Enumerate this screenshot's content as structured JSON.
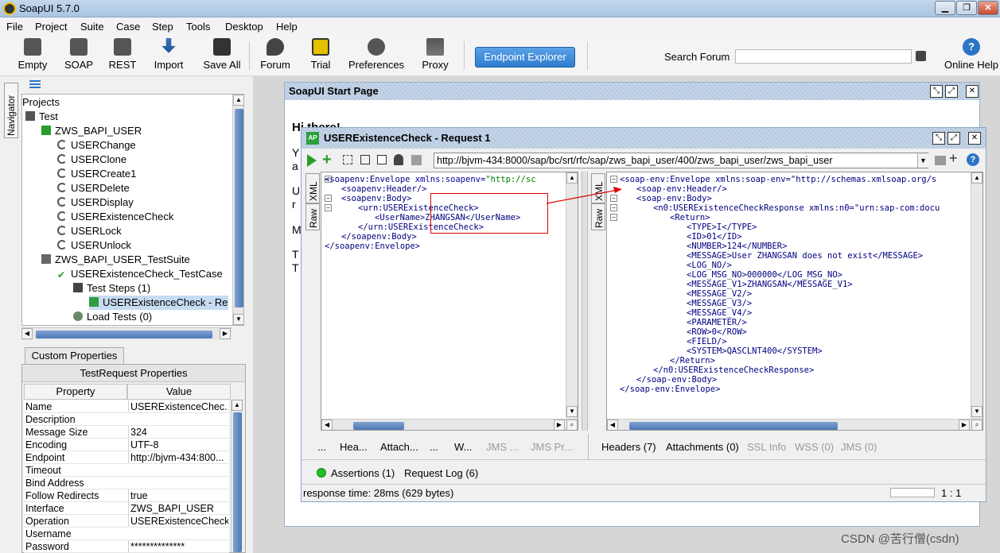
{
  "app": {
    "title": "SoapUI 5.7.0"
  },
  "menu": [
    "File",
    "Project",
    "Suite",
    "Case",
    "Step",
    "Tools",
    "Desktop",
    "Help"
  ],
  "toolbar": {
    "buttons": [
      "Empty",
      "SOAP",
      "REST",
      "Import",
      "Save All",
      "Forum",
      "Trial",
      "Preferences",
      "Proxy"
    ],
    "endpoint_explorer": "Endpoint Explorer",
    "search_label": "Search Forum",
    "online_help": "Online Help"
  },
  "navigator": {
    "tab": "Navigator",
    "header": "Projects",
    "tree": [
      {
        "label": "Test",
        "icon": "folder-icon"
      },
      {
        "label": "ZWS_BAPI_USER",
        "icon": "interface-icon"
      },
      {
        "label": "USERChange",
        "icon": "operation-icon"
      },
      {
        "label": "USERClone",
        "icon": "operation-icon"
      },
      {
        "label": "USERCreate1",
        "icon": "operation-icon"
      },
      {
        "label": "USERDelete",
        "icon": "operation-icon"
      },
      {
        "label": "USERDisplay",
        "icon": "operation-icon"
      },
      {
        "label": "USERExistenceCheck",
        "icon": "operation-icon"
      },
      {
        "label": "USERLock",
        "icon": "operation-icon"
      },
      {
        "label": "USERUnlock",
        "icon": "operation-icon"
      },
      {
        "label": "ZWS_BAPI_USER_TestSuite",
        "icon": "testsuite-icon"
      },
      {
        "label": "USERExistenceCheck_TestCase",
        "icon": "check-icon"
      },
      {
        "label": "Test Steps (1)",
        "icon": "steps-icon"
      },
      {
        "label": "USERExistenceCheck - Re",
        "icon": "request-icon"
      },
      {
        "label": "Load Tests (0)",
        "icon": "loadtest-icon"
      }
    ]
  },
  "properties": {
    "tab": "Custom Properties",
    "title": "TestRequest Properties",
    "col_property": "Property",
    "col_value": "Value",
    "rows": [
      {
        "k": "Name",
        "v": "USERExistenceChec..."
      },
      {
        "k": "Description",
        "v": ""
      },
      {
        "k": "Message Size",
        "v": "324"
      },
      {
        "k": "Encoding",
        "v": "UTF-8"
      },
      {
        "k": "Endpoint",
        "v": "http://bjvm-434:800..."
      },
      {
        "k": "Timeout",
        "v": ""
      },
      {
        "k": "Bind Address",
        "v": ""
      },
      {
        "k": "Follow Redirects",
        "v": "true"
      },
      {
        "k": "Interface",
        "v": "ZWS_BAPI_USER"
      },
      {
        "k": "Operation",
        "v": "USERExistenceCheck"
      },
      {
        "k": "Username",
        "v": ""
      },
      {
        "k": "Password",
        "v": "**************"
      }
    ]
  },
  "startpage": {
    "title": "SoapUI Start Page",
    "letters": [
      "Hi there!",
      "Y",
      "a",
      "U",
      "r",
      "M",
      "T",
      "T"
    ]
  },
  "request": {
    "title": "USERExistenceCheck - Request 1",
    "url": "http://bjvm-434:8000/sap/bc/srt/rfc/sap/zws_bapi_user/400/zws_bapi_user/zws_bapi_user",
    "side_tabs": [
      "XML",
      "Raw"
    ],
    "req_lines": [
      [
        "<soapenv:Envelope",
        " xmlns:soapenv=",
        "\"http://sc"
      ],
      [
        "<soapenv:Header/>",
        "",
        ""
      ],
      [
        "<soapenv:Body>",
        "",
        ""
      ],
      [
        "<urn:USERExistenceCheck>",
        "",
        ""
      ],
      [
        "<UserName>",
        "",
        "ZHANGSAN</UserName>"
      ],
      [
        "</urn:USERExistenceCheck>",
        "",
        ""
      ],
      [
        "</soapenv:Body>",
        "",
        ""
      ],
      [
        "</soapenv:Envelope>",
        "",
        ""
      ]
    ],
    "resp_lines": [
      "<soap-env:Envelope xmlns:soap-env=\"http://schemas.xmlsoap.org/s",
      "<soap-env:Header/>",
      "<soap-env:Body>",
      "<n0:USERExistenceCheckResponse xmlns:n0=\"urn:sap-com:docu",
      "<Return>",
      "<TYPE>I</TYPE>",
      "<ID>01</ID>",
      "<NUMBER>124</NUMBER>",
      "<MESSAGE>User ZHANGSAN does not exist</MESSAGE>",
      "<LOG_NO/>",
      "<LOG_MSG_NO>000000</LOG_MSG_NO>",
      "<MESSAGE_V1>ZHANGSAN</MESSAGE_V1>",
      "<MESSAGE_V2/>",
      "<MESSAGE_V3/>",
      "<MESSAGE_V4/>",
      "<PARAMETER/>",
      "<ROW>0</ROW>",
      "<FIELD/>",
      "<SYSTEM>QASCLNT400</SYSTEM>",
      "</Return>",
      "</n0:USERExistenceCheckResponse>",
      "</soap-env:Body>",
      "</soap-env:Envelope>"
    ],
    "req_tabs": [
      "...",
      "Hea...",
      "Attach...",
      "...",
      "W...",
      "JMS ...",
      "JMS Pr..."
    ],
    "resp_tabs": [
      "Headers (7)",
      "Attachments (0)",
      "SSL Info",
      "WSS (0)",
      "JMS (0)"
    ],
    "assertions": "Assertions (1)",
    "request_log": "Request Log (6)",
    "status": "response time: 28ms (629 bytes)",
    "position": "1 : 1"
  },
  "watermark": "CSDN @苦行僧(csdn)"
}
